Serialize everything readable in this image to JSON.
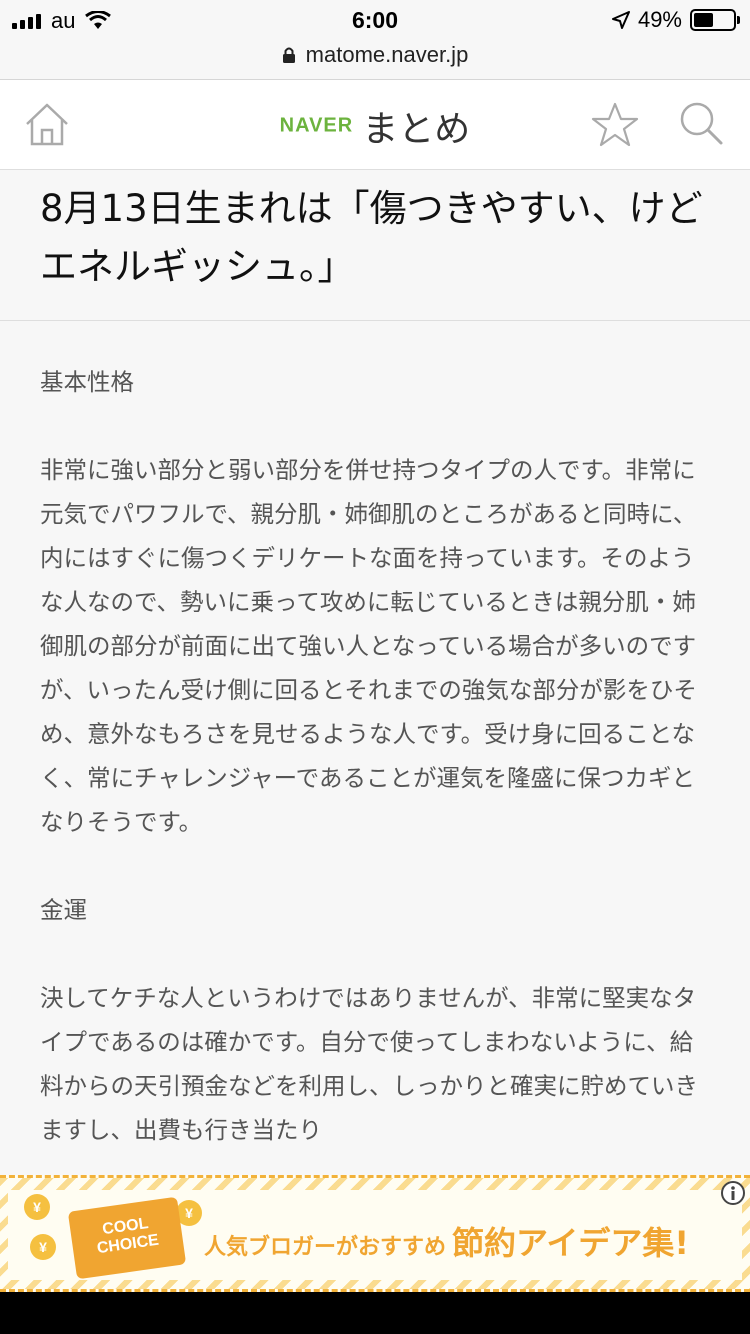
{
  "status_bar": {
    "carrier": "au",
    "time": "6:00",
    "battery_percent": "49%",
    "battery_level": 0.49
  },
  "url_bar": {
    "url": "matome.naver.jp"
  },
  "header": {
    "logo_brand": "NAVER",
    "logo_text": "まとめ",
    "brand_color": "#6cb33e",
    "icons": [
      "home-icon",
      "star-icon",
      "search-icon"
    ]
  },
  "article": {
    "title": "8月13日生まれは「傷つきやすい、けどエネルギッシュ。」",
    "sections": [
      {
        "heading": "基本性格",
        "body": "非常に強い部分と弱い部分を併せ持つタイプの人です。非常に元気でパワフルで、親分肌・姉御肌のところがあると同時に、内にはすぐに傷つくデリケートな面を持っています。そのような人なので、勢いに乗って攻めに転じているときは親分肌・姉御肌の部分が前面に出て強い人となっている場合が多いのですが、いったん受け側に回るとそれまでの強気な部分が影をひそめ、意外なもろさを見せるような人です。受け身に回ることなく、常にチャレンジャーであることが運気を隆盛に保つカギとなりそうです。"
      },
      {
        "heading": "金運",
        "body": "決してケチな人というわけではありませんが、非常に堅実なタイプであるのは確かです。自分で使ってしまわないように、給料からの天引預金などを利用し、しっかりと確実に貯めていきますし、出費も行き当たり"
      }
    ]
  },
  "ad": {
    "badge_line1": "COOL",
    "badge_line2": "CHOICE",
    "coin_symbol": "¥",
    "text_small": "人気ブロガーがおすすめ",
    "text_big": "節約アイデア集!",
    "accent_color": "#f0a531"
  }
}
